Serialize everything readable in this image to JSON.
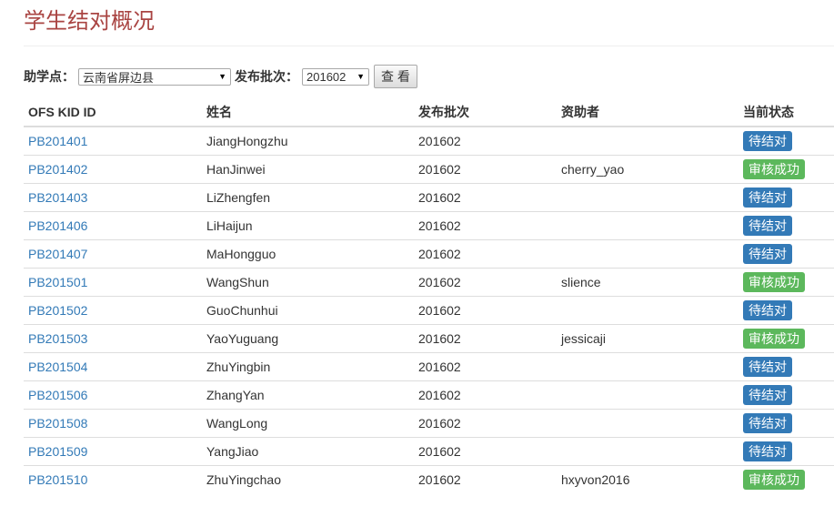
{
  "page": {
    "title": "学生结对概况"
  },
  "filters": {
    "site_label": "助学点：",
    "site_value": "云南省屏边县",
    "batch_label": "发布批次：",
    "batch_value": "201602",
    "view_button": "查 看",
    "dropdown_icon": "triangle-down"
  },
  "colors": {
    "title": "#a94442",
    "link": "#337ab7",
    "pending": "#337ab7",
    "success": "#5cb85c"
  },
  "table": {
    "headers": {
      "id": "OFS KID ID",
      "name": "姓名",
      "batch": "发布批次",
      "sponsor": "资助者",
      "status": "当前状态"
    },
    "rows": [
      {
        "id": "PB201401",
        "name": "JiangHongzhu",
        "batch": "201602",
        "sponsor": "",
        "status": "待结对",
        "status_type": "pending"
      },
      {
        "id": "PB201402",
        "name": "HanJinwei",
        "batch": "201602",
        "sponsor": "cherry_yao",
        "status": "审核成功",
        "status_type": "success"
      },
      {
        "id": "PB201403",
        "name": "LiZhengfen",
        "batch": "201602",
        "sponsor": "",
        "status": "待结对",
        "status_type": "pending"
      },
      {
        "id": "PB201406",
        "name": "LiHaijun",
        "batch": "201602",
        "sponsor": "",
        "status": "待结对",
        "status_type": "pending"
      },
      {
        "id": "PB201407",
        "name": "MaHongguo",
        "batch": "201602",
        "sponsor": "",
        "status": "待结对",
        "status_type": "pending"
      },
      {
        "id": "PB201501",
        "name": "WangShun",
        "batch": "201602",
        "sponsor": "slience",
        "status": "审核成功",
        "status_type": "success"
      },
      {
        "id": "PB201502",
        "name": "GuoChunhui",
        "batch": "201602",
        "sponsor": "",
        "status": "待结对",
        "status_type": "pending"
      },
      {
        "id": "PB201503",
        "name": "YaoYuguang",
        "batch": "201602",
        "sponsor": "jessicaji",
        "status": "审核成功",
        "status_type": "success"
      },
      {
        "id": "PB201504",
        "name": "ZhuYingbin",
        "batch": "201602",
        "sponsor": "",
        "status": "待结对",
        "status_type": "pending"
      },
      {
        "id": "PB201506",
        "name": "ZhangYan",
        "batch": "201602",
        "sponsor": "",
        "status": "待结对",
        "status_type": "pending"
      },
      {
        "id": "PB201508",
        "name": "WangLong",
        "batch": "201602",
        "sponsor": "",
        "status": "待结对",
        "status_type": "pending"
      },
      {
        "id": "PB201509",
        "name": "YangJiao",
        "batch": "201602",
        "sponsor": "",
        "status": "待结对",
        "status_type": "pending"
      },
      {
        "id": "PB201510",
        "name": "ZhuYingchao",
        "batch": "201602",
        "sponsor": "hxyvon2016",
        "status": "审核成功",
        "status_type": "success"
      }
    ]
  }
}
